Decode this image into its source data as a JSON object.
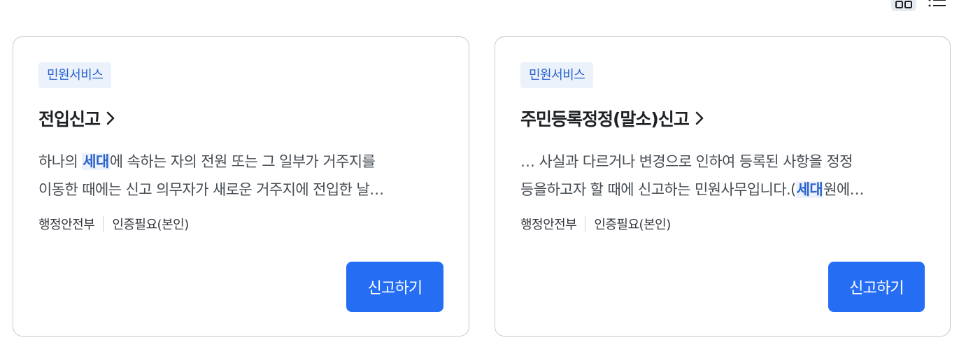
{
  "view_toggle": {
    "grid_icon": "grid-icon",
    "list_icon": "list-icon"
  },
  "cards": [
    {
      "badge": "민원서비스",
      "title": "전입신고",
      "desc_line1_pre": "하나의 ",
      "desc_line1_hl": "세대",
      "desc_line1_post": "에 속하는 자의 전원 또는 그 일부가 거주지를",
      "desc_line2": "이동한 때에는 신고 의무자가 새로운 거주지에 전입한 날…",
      "agency": "행정안전부",
      "auth": "인증필요(본인)",
      "action": "신고하기"
    },
    {
      "badge": "민원서비스",
      "title": "주민등록정정(말소)신고",
      "desc_line1": "… 사실과 다르거나 변경으로 인하여 등록된 사항을 정정",
      "desc_line2_pre": "등을하고자 할 때에 신고하는 민원사무입니다.(",
      "desc_line2_hl": "세대",
      "desc_line2_post": "원에…",
      "agency": "행정안전부",
      "auth": "인증필요(본인)",
      "action": "신고하기"
    }
  ],
  "colors": {
    "primary": "#256ef4",
    "badge_bg": "#ebf2fc",
    "badge_text": "#2b62cc",
    "border": "#c6c9cd"
  }
}
